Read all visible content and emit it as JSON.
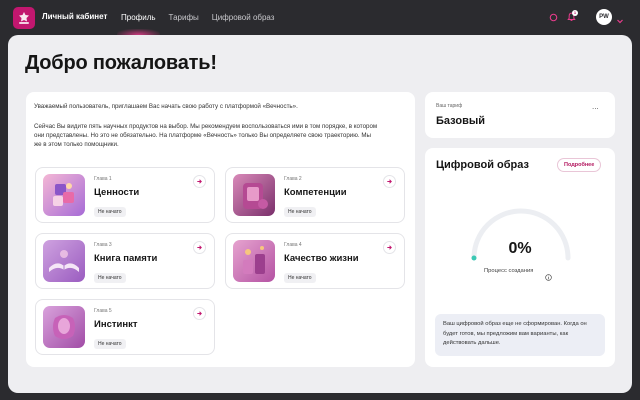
{
  "app": {
    "title": "Личный кабинет",
    "brand_color": "#c2176f",
    "accent_color": "#e83c8c"
  },
  "nav": {
    "items": [
      {
        "label": "Профиль",
        "active": true
      },
      {
        "label": "Тарифы",
        "active": false
      },
      {
        "label": "Цифровой образ",
        "active": false
      }
    ]
  },
  "header_right": {
    "notification_count": "1",
    "avatar_initials": "PW",
    "icons": [
      "bookmark-icon",
      "bell-icon",
      "chevron-down-icon"
    ]
  },
  "main": {
    "welcome": "Добро пожаловать!",
    "intro_1": "Уважаемый пользователь, приглашаем Вас начать свою работу с платформой «Вечность».",
    "intro_2": "Сейчас Вы видите пять научных продуктов на выбор. Мы рекомендуем воспользоваться ими в том порядке, в котором они представлены. Но это не обязательно. На платформе «Вечность» только Вы определяете свою траекторию. Мы же в этом только помощники.",
    "chapters": [
      {
        "label": "Глава 1",
        "title": "Ценности",
        "status": "Не начато"
      },
      {
        "label": "Глава 2",
        "title": "Компетенции",
        "status": "Не начато"
      },
      {
        "label": "Глава 3",
        "title": "Книга памяти",
        "status": "Не начато"
      },
      {
        "label": "Глава 4",
        "title": "Качество жизни",
        "status": "Не начато"
      },
      {
        "label": "Глава 5",
        "title": "Инстинкт",
        "status": "Не начато"
      }
    ]
  },
  "tariff": {
    "label": "Ваш тариф",
    "value": "Базовый",
    "more": "..."
  },
  "digital_twin": {
    "title": "Цифровой образ",
    "more_button": "Подробнее",
    "progress_percent": 0,
    "progress_label": "0%",
    "progress_caption": "Процесс создания",
    "note": "Ваш цифровой образ еще не сформирован. Когда он будет готов, мы предложим вам варианты, как действовать дальше."
  }
}
